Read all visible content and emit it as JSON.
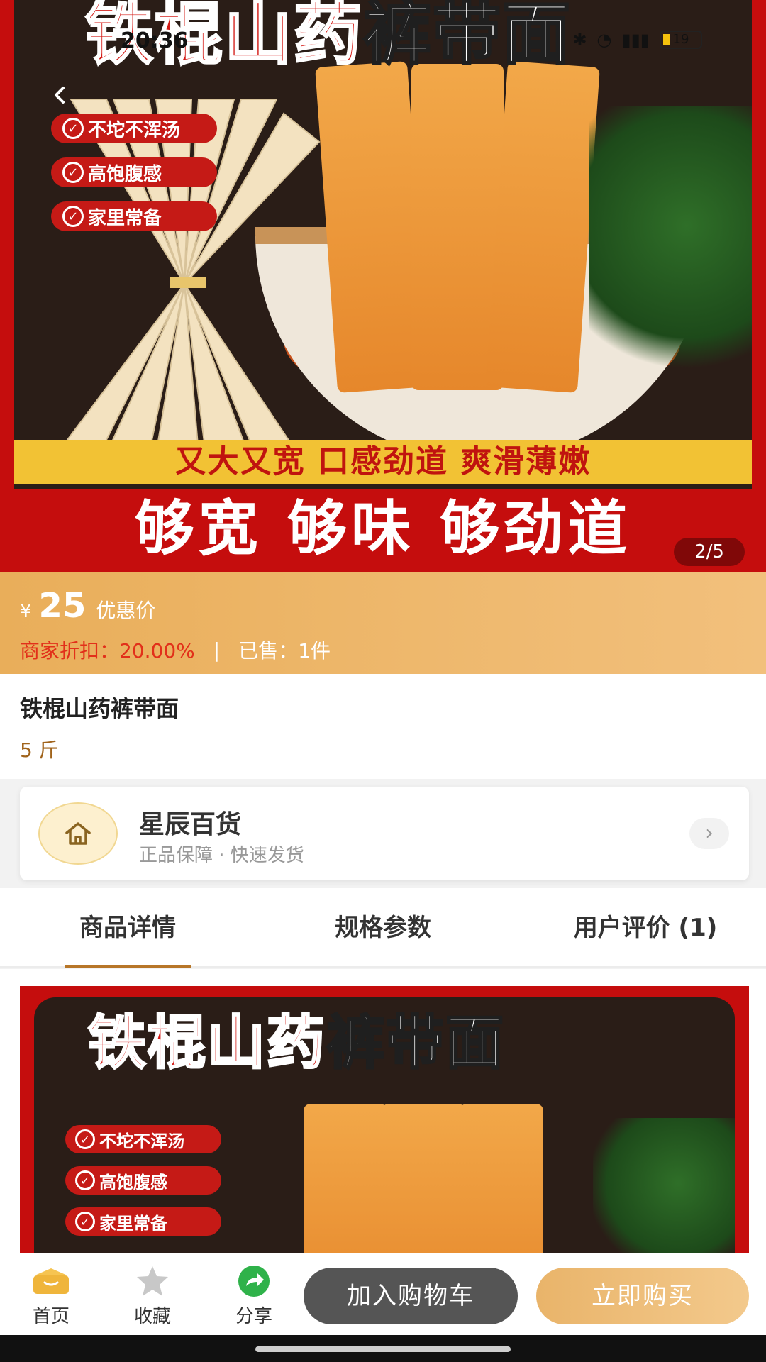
{
  "status_bar": {
    "time": "20:36",
    "battery": "19"
  },
  "hero": {
    "title_red": "铁棍山药",
    "title_dark": "裤带面",
    "badges": [
      "不坨不浑汤",
      "高饱腹感",
      "家里常备"
    ],
    "slogan": "又大又宽 口感劲道 爽滑薄嫩",
    "big_slogan": "够宽 够味 够劲道",
    "image_counter": "2/5"
  },
  "price": {
    "currency": "¥",
    "value": "25",
    "label": "优惠价",
    "discount_text": "商家折扣：20.00%",
    "separator": "|",
    "sold_text": "已售：1件"
  },
  "product": {
    "name": "铁棍山药裤带面",
    "spec": "5 斤"
  },
  "store": {
    "name": "星辰百货",
    "subtitle": "正品保障 · 快速发货"
  },
  "tabs": [
    {
      "label": "商品详情",
      "active": true
    },
    {
      "label": "规格参数",
      "active": false
    },
    {
      "label": "用户评价 (1)",
      "active": false
    }
  ],
  "detail": {
    "title_red": "铁棍山药",
    "title_dark": "裤带面",
    "badges": [
      "不坨不浑汤",
      "高饱腹感",
      "家里常备"
    ]
  },
  "bottom_bar": {
    "home": "首页",
    "favorite": "收藏",
    "share": "分享",
    "add_to_cart": "加入购物车",
    "buy_now": "立即购买"
  },
  "colors": {
    "brand_red": "#c50d0d",
    "price_gold": "#e9ae5a",
    "tab_accent": "#b77628",
    "cart_button": "#555555"
  }
}
